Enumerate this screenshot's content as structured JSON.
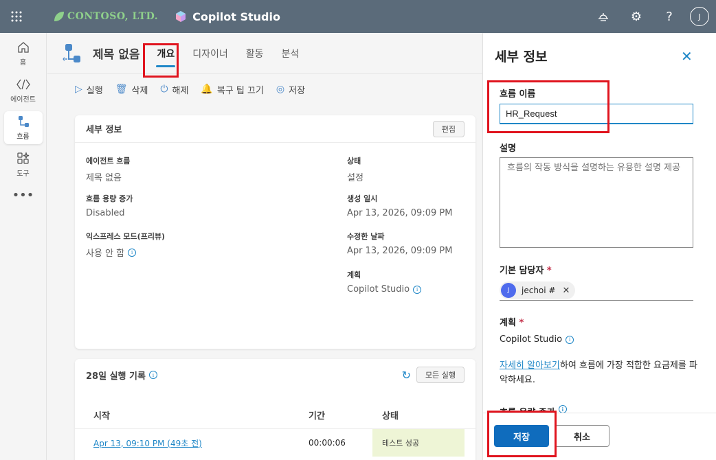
{
  "topbar": {
    "brand": "CONTOSO, LTD.",
    "product": "Copilot Studio",
    "avatar": "J",
    "help": "?"
  },
  "leftnav": {
    "items": [
      {
        "label": "홈",
        "icon": "home-icon"
      },
      {
        "label": "에이전트",
        "icon": "agent-icon"
      },
      {
        "label": "흐름",
        "icon": "flow-icon",
        "active": true
      },
      {
        "label": "도구",
        "icon": "tools-icon"
      }
    ],
    "more": "•••"
  },
  "header": {
    "title": "제목 없음",
    "tabs": [
      "개요",
      "디자이너",
      "활동",
      "분석"
    ]
  },
  "commands": [
    {
      "label": "실행",
      "icon": "▷"
    },
    {
      "label": "삭제",
      "icon": "🗑"
    },
    {
      "label": "해제",
      "icon": "⏻"
    },
    {
      "label": "복구 팁 끄기",
      "icon": "🔔"
    },
    {
      "label": "저장",
      "icon": "◎"
    }
  ],
  "details_card": {
    "title": "세부 정보",
    "edit": "편집",
    "fields": {
      "agent_flow": {
        "label": "에이전트 흐름",
        "value": "제목 없음"
      },
      "capacity": {
        "label": "흐름 용량 증가",
        "value": "Disabled"
      },
      "express": {
        "label": "익스프레스 모드(프리뷰)",
        "value": "사용 안 함"
      },
      "status": {
        "label": "상태",
        "value": "설정"
      },
      "created": {
        "label": "생성 일시",
        "value": "Apr 13, 2026, 09:09 PM"
      },
      "modified": {
        "label": "수정한 날짜",
        "value": "Apr 13, 2026, 09:09 PM"
      },
      "plan": {
        "label": "계획",
        "value": "Copilot Studio"
      }
    }
  },
  "runs_card": {
    "title": "28일 실행 기록",
    "all_runs": "모든 실행",
    "columns": [
      "시작",
      "기간",
      "상태"
    ],
    "rows": [
      {
        "start": "Apr 13, 09:10 PM (49초 전)",
        "duration": "00:00:06",
        "status": "테스트 성공"
      }
    ]
  },
  "panel": {
    "title": "세부 정보",
    "close": "✕",
    "flow_name_label": "흐름 이름",
    "flow_name_value": "HR_Request",
    "description_label": "설명",
    "description_placeholder": "흐름의 작동 방식을 설명하는 유용한 설명 제공",
    "owner_label": "기본 담당자",
    "required": "*",
    "owner_initial": "J",
    "owner_name": "jechoi #",
    "plan_label": "계획",
    "plan_value": "Copilot Studio",
    "learn_more_link": "자세히 알아보기",
    "learn_more_text": "하여 흐름에 가장 적합한 요금제를 파악하세요.",
    "capacity_label": "흐름 용량 증가",
    "save": "저장",
    "cancel": "취소"
  },
  "colors": {
    "topbar": "#5b6b7a",
    "accent": "#1f87c7",
    "primary_button": "#0f6cbd",
    "highlight": "#e0141e"
  }
}
